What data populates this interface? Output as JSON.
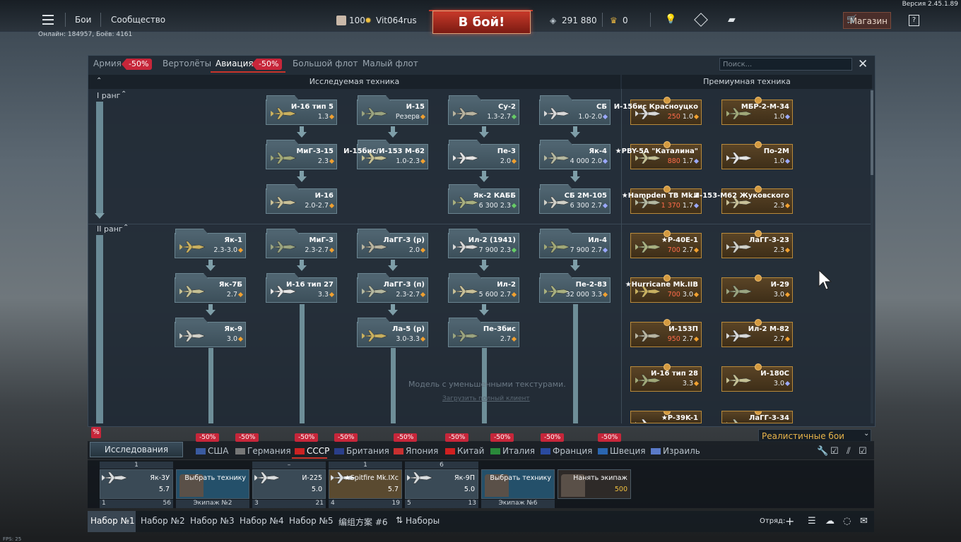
{
  "version": "Версия 2.45.1.89",
  "topbar": {
    "battles": "Бои",
    "community": "Сообщество",
    "online": "Онлайн: 184957, Боёв: 4161",
    "level": "100",
    "username": "Vit064rus",
    "battle_button": "В бой!",
    "silver_lions": "291 880",
    "golden_eagles": "0",
    "shop": "Магазин"
  },
  "tabs": {
    "army": "Армия",
    "army_discount": "-50%",
    "helicopters": "Вертолёты",
    "aviation": "Авиация",
    "aviation_discount": "-50%",
    "big_fleet": "Большой флот",
    "small_fleet": "Малый флот",
    "search_placeholder": "Поиск..."
  },
  "sections": {
    "research": "Исследуемая техника",
    "premium": "Премиумная техника"
  },
  "ranks": {
    "r1": "I ранг",
    "r2": "II ранг"
  },
  "tree": [
    {
      "name": "И-16 тип 5",
      "br": "1.3",
      "cur": "o"
    },
    {
      "name": "И-15",
      "br": "Резерв",
      "cur": "o"
    },
    {
      "name": "Су-2",
      "br": "1.3-2.7",
      "cur": "g"
    },
    {
      "name": "СБ",
      "br": "1.0-2.0",
      "cur": "b"
    },
    {
      "name": "МиГ-3-15",
      "br": "2.3",
      "cur": "o"
    },
    {
      "name": "И-15бис/И-153 М-62",
      "br": "1.0-2.3",
      "cur": "o"
    },
    {
      "name": "Пе-3",
      "br": "2.0",
      "cur": "o"
    },
    {
      "name": "Як-4",
      "pre": "4 000",
      "br": "2.0",
      "cur": "b"
    },
    {
      "name": "И-16",
      "br": "2.0-2.7",
      "cur": "o"
    },
    {
      "name": "Як-2 КАББ",
      "pre": "6 300",
      "br": "2.3",
      "cur": "g"
    },
    {
      "name": "СБ 2М-105",
      "pre": "6 300",
      "br": "2.7",
      "cur": "b"
    },
    {
      "name": "Як-1",
      "br": "2.3-3.0",
      "cur": "o"
    },
    {
      "name": "МиГ-3",
      "br": "2.3-2.7",
      "cur": "o"
    },
    {
      "name": "ЛаГГ-3 (р)",
      "br": "2.0",
      "cur": "o"
    },
    {
      "name": "Ил-2 (1941)",
      "pre": "7 900",
      "br": "2.3",
      "cur": "g"
    },
    {
      "name": "Ил-4",
      "pre": "7 900",
      "br": "2.7",
      "cur": "b"
    },
    {
      "name": "Як-7Б",
      "br": "2.7",
      "cur": "o"
    },
    {
      "name": "И-16 тип 27",
      "br": "3.3",
      "cur": "o"
    },
    {
      "name": "ЛаГГ-3 (п)",
      "br": "2.3-2.7",
      "cur": "o"
    },
    {
      "name": "Ил-2",
      "pre": "5 600",
      "br": "2.7",
      "cur": "o"
    },
    {
      "name": "Пе-2-83",
      "pre": "32 000",
      "br": "3.3",
      "cur": "o"
    },
    {
      "name": "Як-9",
      "br": "3.0",
      "cur": "o"
    },
    {
      "name": "Ла-5 (р)",
      "br": "3.0-3.3",
      "cur": "o"
    },
    {
      "name": "Пе-3бис",
      "br": "2.7",
      "cur": "o"
    }
  ],
  "premium": [
    {
      "name": "И-15бис Красноуцко",
      "cost": "250",
      "br": "1.0",
      "cur": "o"
    },
    {
      "name": "МБР-2-М-34",
      "br": "1.0",
      "cur": "b"
    },
    {
      "name": "★PBY-5A \"Каталина\"",
      "cost": "880",
      "br": "1.7",
      "cur": "b"
    },
    {
      "name": "По-2М",
      "br": "1.0",
      "cur": "b"
    },
    {
      "name": "★Hampden TB Mk.I",
      "cost": "1 370",
      "br": "1.7",
      "cur": "b"
    },
    {
      "name": "И-153-М62 Жуковского",
      "br": "2.3",
      "cur": "o"
    },
    {
      "name": "★P-40E-1",
      "cost": "700",
      "br": "2.7",
      "cur": "o"
    },
    {
      "name": "ЛаГГ-3-23",
      "br": "2.3",
      "cur": "o"
    },
    {
      "name": "★Hurricane Mk.IIB",
      "cost": "700",
      "br": "3.0",
      "cur": "o"
    },
    {
      "name": "И-29",
      "br": "3.0",
      "cur": "o"
    },
    {
      "name": "И-153П",
      "cost": "950",
      "br": "2.7",
      "cur": "o"
    },
    {
      "name": "Ил-2 М-82",
      "br": "2.7",
      "cur": "o"
    },
    {
      "name": "И-16 тип 28",
      "br": "3.3",
      "cur": "o"
    },
    {
      "name": "И-180С",
      "br": "3.0",
      "cur": "b"
    },
    {
      "name": "★P-39K-1",
      "br": "",
      "cur": "o"
    },
    {
      "name": "ЛаГГ-3-34",
      "br": "",
      "cur": "o"
    }
  ],
  "watermark": "Модель с уменьшенными текстурами.",
  "watermark_link": "Загрузить полный клиент",
  "research_button": "Исследования",
  "percent_badge": "%",
  "mode": "Реалистичные бои",
  "nations": [
    {
      "name": "США",
      "disc": "-50%",
      "color": "#3a5aa0"
    },
    {
      "name": "Германия",
      "disc": "-50%",
      "color": "#777777"
    },
    {
      "name": "СССР",
      "disc": "-50%",
      "color": "#cc2222"
    },
    {
      "name": "Британия",
      "disc": "-50%",
      "color": "#2a3e8a"
    },
    {
      "name": "Япония",
      "disc": "-50%",
      "color": "#c83030"
    },
    {
      "name": "Китай",
      "disc": "-50%",
      "color": "#d02020"
    },
    {
      "name": "Италия",
      "disc": "-50%",
      "color": "#2a8a3a"
    },
    {
      "name": "Франция",
      "disc": "-50%",
      "color": "#2a4aa0"
    },
    {
      "name": "Швеция",
      "disc": "-50%",
      "color": "#2a66b0"
    },
    {
      "name": "Израиль",
      "disc": "",
      "color": "#5a7ac8"
    }
  ],
  "slots": [
    {
      "name": "Як-3У",
      "br": "5.7",
      "top": "1",
      "foot_left": "1",
      "foot_right": "56"
    },
    {
      "name": "Выбрать технику",
      "foot": "Экипаж №2"
    },
    {
      "name": "И-225",
      "br": "5.0",
      "top": "–",
      "foot_left": "3",
      "foot_right": "21"
    },
    {
      "name": "★Spitfire Mk.IXc",
      "br": "5.7",
      "top": "1",
      "foot_left": "4",
      "foot_right": "19"
    },
    {
      "name": "Як-9П",
      "br": "5.0",
      "top": "6",
      "foot_left": "5",
      "foot_right": "13"
    },
    {
      "name": "Выбрать технику",
      "foot": "Экипаж №6"
    },
    {
      "name": "Нанять экипаж",
      "cost": "500"
    }
  ],
  "presets": [
    "Набор №1",
    "Набор №2",
    "Набор №3",
    "Набор №4",
    "Набор №5",
    "编组方案 #6",
    "Наборы"
  ],
  "squad": "Отряд:",
  "fps": "FPS: 25"
}
